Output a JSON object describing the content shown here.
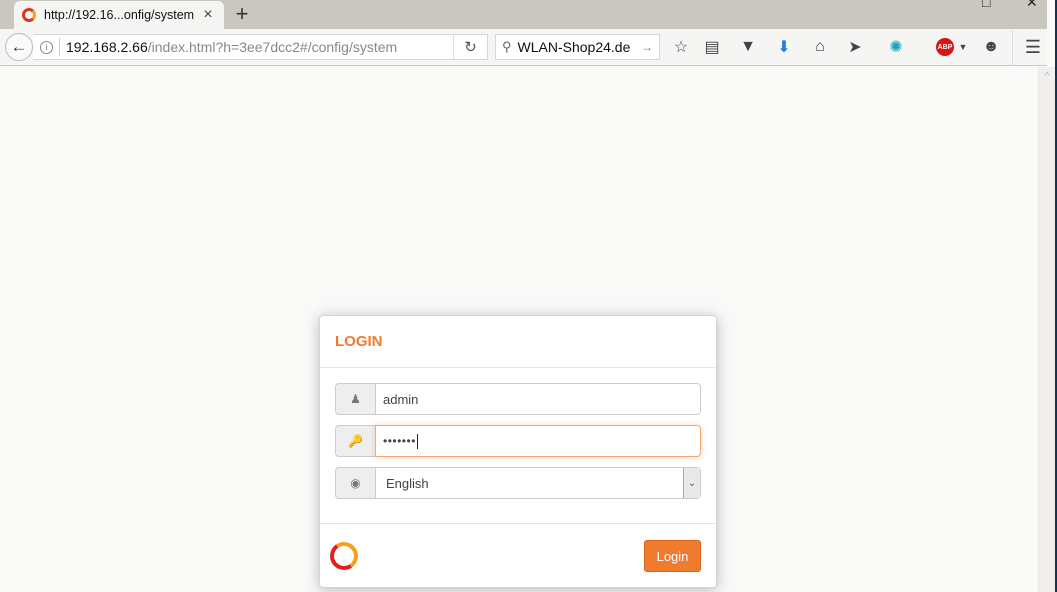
{
  "browser": {
    "tab": {
      "title": "http://192.16...onfig/system",
      "close_icon": "×",
      "favicon": "vodafone-logo"
    },
    "new_tab_label": "+",
    "window_controls": {
      "maximize": "□",
      "close": "✕"
    },
    "url": {
      "host": "192.168.2.66",
      "path": "/index.html?h=3ee7dcc2#/config/system"
    },
    "search": {
      "value": "WLAN-Shop24.de"
    },
    "toolbar_icons": [
      "bookmark-star-icon",
      "reading-list-icon",
      "pocket-icon",
      "download-icon",
      "home-icon",
      "send-icon",
      "extension-icon",
      "adblock-plus-icon",
      "chat-icon",
      "menu-icon"
    ],
    "abp_label": "ABP"
  },
  "login": {
    "title": "LOGIN",
    "username": "admin",
    "password_mask": "•••••••",
    "language": "English",
    "submit_label": "Login"
  },
  "colors": {
    "accent": "#f07a2e",
    "brand_red": "#e51d1d"
  }
}
